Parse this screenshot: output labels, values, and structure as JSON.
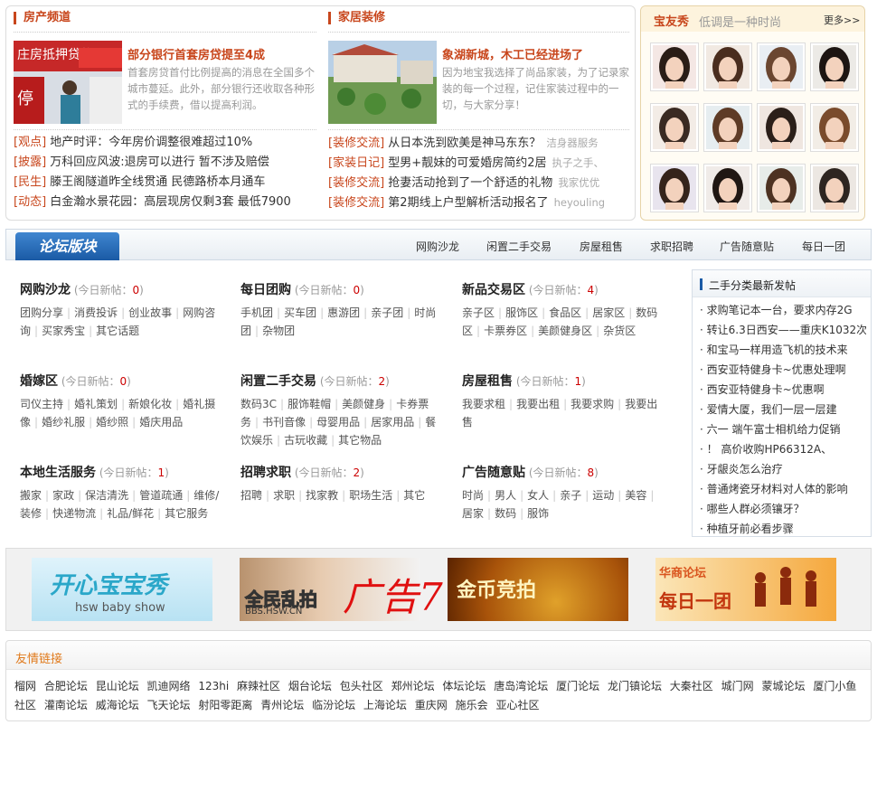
{
  "realestate": {
    "title": "房产频道",
    "feature": {
      "title": "部分银行首套房贷提至4成",
      "desc": "首套房贷首付比例提高的消息在全国多个城市蔓延。此外，部分银行还收取各种形式的手续费，借以提高利润。"
    },
    "news": [
      {
        "tag": "[观点]",
        "text": "地产时评：今年房价调整很难超过10%"
      },
      {
        "tag": "[披露]",
        "text": "万科回应风波:退房可以进行 暂不涉及赔偿"
      },
      {
        "tag": "[民生]",
        "text": "滕王阁隧道昨全线贯通 民德路桥本月通车"
      },
      {
        "tag": "[动态]",
        "text": "白金瀚水景花园：高层现房仅剩3套 最低7900"
      }
    ]
  },
  "home": {
    "title": "家居装修",
    "feature": {
      "title": "象湖新城，木工已经进场了",
      "desc": "因为地宝我选择了尚品家装，为了记录家装的每一个过程，记住家装过程中的一切，与大家分享！"
    },
    "news": [
      {
        "tag": "[装修交流]",
        "text": "从日本洗到欧美是神马东东？",
        "src": "洁身器服务"
      },
      {
        "tag": "[家装日记]",
        "text": "型男+靓妹的可爱婚房简约2居",
        "src": "执子之手、"
      },
      {
        "tag": "[装修交流]",
        "text": "抢妻活动抢到了一个舒适的礼物",
        "src": "我家优优"
      },
      {
        "tag": "[装修交流]",
        "text": "第2期线上户型解析活动报名了",
        "src": "heyouling"
      }
    ]
  },
  "baby": {
    "title": "宝友秀",
    "slogan": "低调是一种时尚",
    "more": "更多>>"
  },
  "forum": {
    "tab": "论坛版块",
    "nav": [
      "网购沙龙",
      "闲置二手交易",
      "房屋租售",
      "求职招聘",
      "广告随意贴",
      "每日一团"
    ],
    "today_label": "(今日新帖：",
    "today_close": ")",
    "boards": [
      {
        "name": "网购沙龙",
        "count": "0",
        "links": [
          "团购分享",
          "消费投诉",
          "创业故事",
          "网购咨询",
          "买家秀宝",
          "其它话题"
        ]
      },
      {
        "name": "每日团购",
        "count": "0",
        "links": [
          "手机团",
          "买车团",
          "惠游团",
          "亲子团",
          "时尚团",
          "杂物团"
        ]
      },
      {
        "name": "新品交易区",
        "count": "4",
        "links": [
          "亲子区",
          "服饰区",
          "食品区",
          "居家区",
          "数码区",
          "卡票券区",
          "美颜健身区",
          "杂货区"
        ]
      },
      {
        "name": "婚嫁区",
        "count": "0",
        "links": [
          "司仪主持",
          "婚礼策划",
          "新娘化妆",
          "婚礼摄像",
          "婚纱礼服",
          "婚纱照",
          "婚庆用品"
        ]
      },
      {
        "name": "闲置二手交易",
        "count": "2",
        "links": [
          "数码3C",
          "服饰鞋帽",
          "美颜健身",
          "卡券票务",
          "书刊音像",
          "母婴用品",
          "居家用品",
          "餐饮娱乐",
          "古玩收藏",
          "其它物品"
        ]
      },
      {
        "name": "房屋租售",
        "count": "1",
        "links": [
          "我要求租",
          "我要出租",
          "我要求购",
          "我要出售"
        ]
      },
      {
        "name": "本地生活服务",
        "count": "1",
        "links": [
          "搬家",
          "家政",
          "保洁清洗",
          "管道疏通",
          "维修/装修",
          "快递物流",
          "礼品/鲜花",
          "其它服务"
        ]
      },
      {
        "name": "招聘求职",
        "count": "2",
        "links": [
          "招聘",
          "求职",
          "找家教",
          "职场生活",
          "其它"
        ]
      },
      {
        "name": "广告随意贴",
        "count": "8",
        "links": [
          "时尚",
          "男人",
          "女人",
          "亲子",
          "运动",
          "美容",
          "居家",
          "数码",
          "服饰"
        ]
      }
    ]
  },
  "classifieds": {
    "title": "二手分类最新发帖",
    "items": [
      "求购笔记本一台，要求内存2G",
      "转让6.3日西安——重庆K1032次",
      "和宝马一样用造飞机的技术来",
      "西安亚特健身卡~优惠处理啊",
      "西安亚特健身卡~优惠啊",
      "爱情大厦，我们一层一层建",
      "六一 端午富士相机给力促销",
      "！ 高价收购HP66312A、",
      "牙龈炎怎么治疗",
      "普通烤瓷牙材料对人体的影响",
      "哪些人群必须镶牙？",
      "种植牙前必看步骤"
    ]
  },
  "ads": {
    "ad1_main": "开心宝宝秀",
    "ad1_sub": "hsw baby show",
    "ad2_main": "全民乱拍",
    "ad2_sub": "BBS.HSW.CN",
    "ad_overlay": "广告7",
    "ad3_main": "金币竞拍",
    "ad4_top": "华商论坛",
    "ad4_main": "每日一团"
  },
  "links": {
    "title": "友情链接",
    "items": [
      "榴网",
      "合肥论坛",
      "昆山论坛",
      "凯迪网络",
      "123hi",
      "麻辣社区",
      "烟台论坛",
      "包头社区",
      "郑州论坛",
      "体坛论坛",
      "唐岛湾论坛",
      "厦门论坛",
      "龙门镇论坛",
      "大秦社区",
      "城门网",
      "蒙城论坛",
      "厦门小鱼社区",
      "灌南论坛",
      "威海论坛",
      "飞天论坛",
      "射阳零距离",
      "青州论坛",
      "临汾论坛",
      "上海论坛",
      "重庆网",
      "施乐会",
      "亚心社区"
    ]
  }
}
